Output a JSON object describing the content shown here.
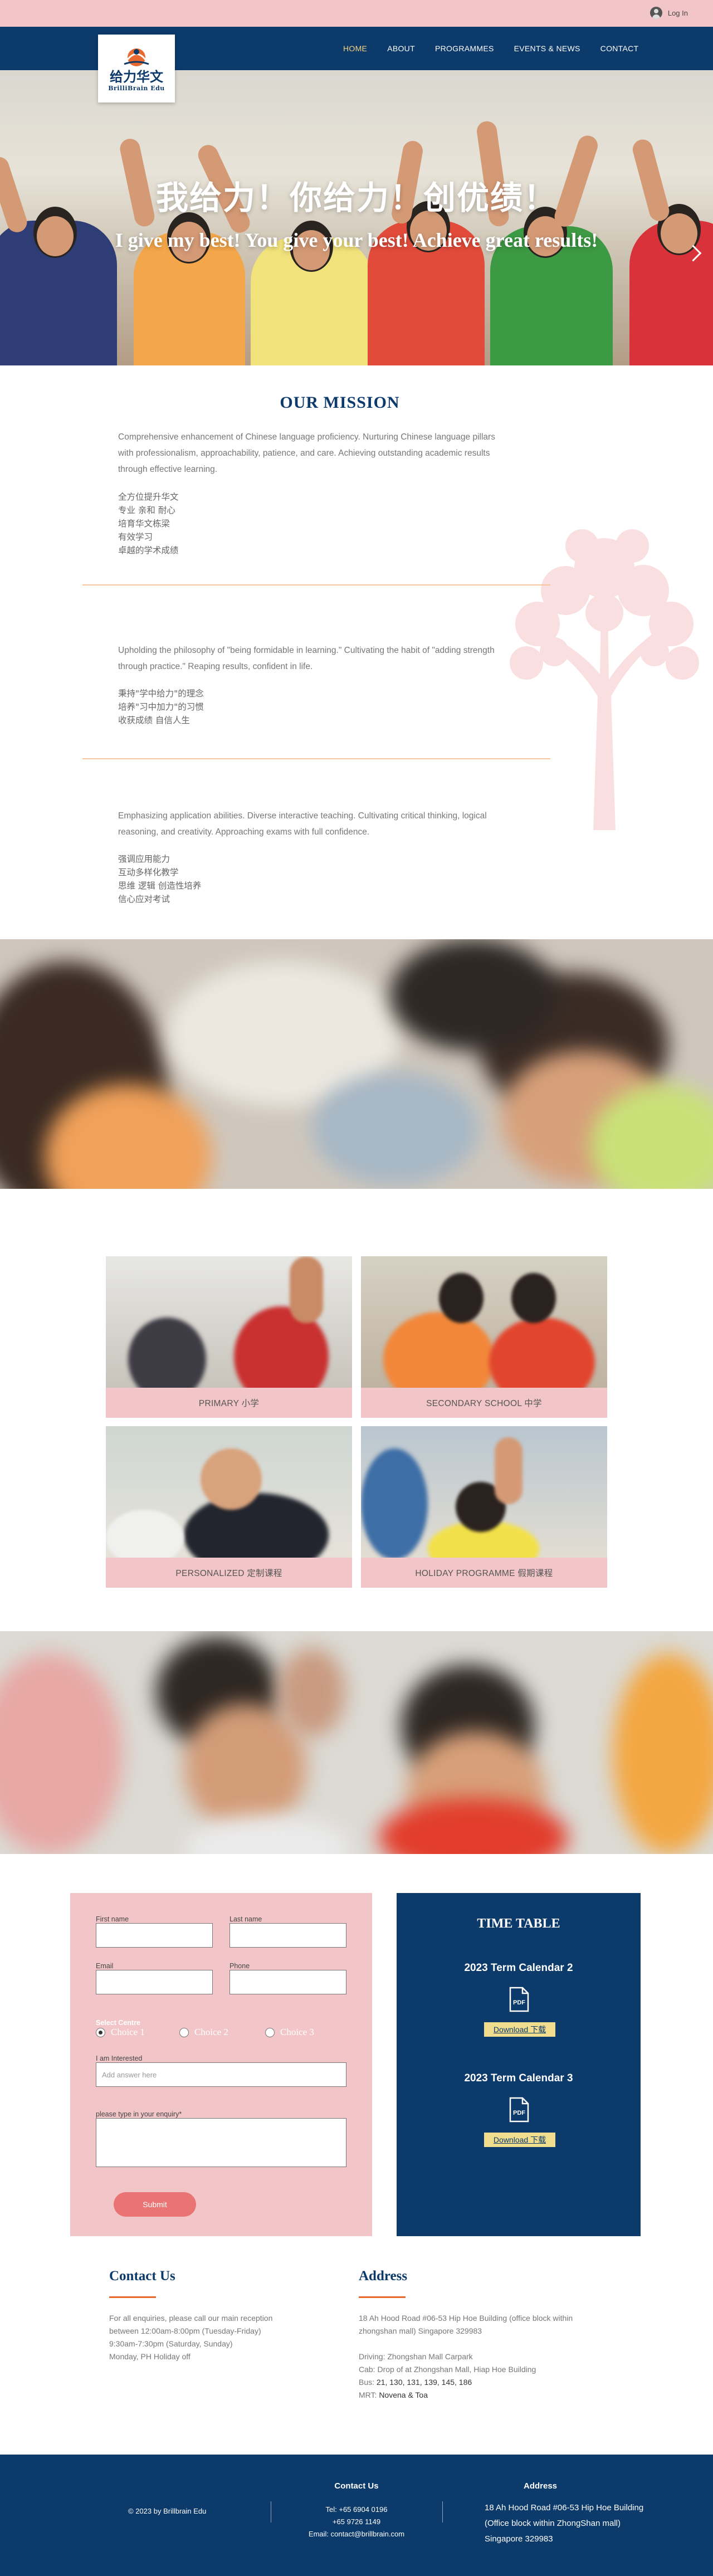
{
  "login": {
    "label": "Log In"
  },
  "brand": {
    "logo_cn": "给力华文",
    "logo_en": "BrilliBrain Edu"
  },
  "nav": {
    "items": [
      "HOME",
      "ABOUT",
      "PROGRAMMES",
      "EVENTS & NEWS",
      "CONTACT"
    ],
    "active": "HOME"
  },
  "hero": {
    "title_cn": "我给力！你给力！创优绩！",
    "title_en": "I give my best! You give your best! Achieve great results!"
  },
  "mission": {
    "title": "OUR MISSION",
    "blocks": [
      {
        "en": "Comprehensive enhancement of Chinese language proficiency. Nurturing Chinese language pillars with professionalism, approachability, patience, and care. Achieving outstanding academic results through effective learning.",
        "cn": [
          "全方位提升华文",
          "专业 亲和 耐心",
          "培育华文栋梁",
          "有效学习",
          "卓越的学术成绩"
        ]
      },
      {
        "en": "Upholding the philosophy of \"being formidable in learning.\" Cultivating the habit of \"adding strength through practice.\" Reaping results, confident in life.",
        "cn": [
          "秉持\"学中给力\"的理念",
          "培养\"习中加力\"的习惯",
          "收获成绩 自信人生"
        ]
      },
      {
        "en": "Emphasizing application abilities. Diverse interactive teaching. Cultivating critical thinking, logical reasoning, and creativity. Approaching exams with full confidence.",
        "cn": [
          "强调应用能力",
          "互动多样化教学",
          "思维 逻辑 创造性培养",
          "信心应对考试"
        ]
      }
    ]
  },
  "programmes": [
    {
      "label": "PRIMARY 小学"
    },
    {
      "label": "SECONDARY SCHOOL 中学"
    },
    {
      "label": "PERSONALIZED 定制课程"
    },
    {
      "label": "HOLIDAY PROGRAMME 假期课程"
    }
  ],
  "form": {
    "first_name_label": "First name",
    "last_name_label": "Last name",
    "email_label": "Email",
    "phone_label": "Phone",
    "centre_label": "Select Centre",
    "choices": [
      "Choice 1",
      "Choice 2",
      "Choice 3"
    ],
    "selected_choice": "Choice 1",
    "interest_label": "I am Interested",
    "interest_placeholder": "Add answer here",
    "enquiry_label": "please type in your enquiry*",
    "submit_label": "Submit"
  },
  "timetable": {
    "title": "TIME TABLE",
    "terms": [
      {
        "label": "2023 Term Calendar 2",
        "download": "Download 下载"
      },
      {
        "label": "2023 Term Calendar 3",
        "download": "Download 下载"
      }
    ]
  },
  "contact": {
    "title": "Contact Us",
    "lines": [
      "For all enquiries, please call our main reception",
      "between 12:00am-8:00pm (Tuesday-Friday)",
      "9:30am-7:30pm (Saturday, Sunday)",
      "Monday, PH Holiday off"
    ]
  },
  "address": {
    "title": "Address",
    "lines": [
      "18 Ah Hood Road #06-53 Hip Hoe Building (office block within",
      "zhongshan mall) Singapore 329983"
    ],
    "driving": "Driving: Zhongshan Mall Carpark",
    "cab": "Cab: Drop of at Zhongshan Mall, Hiap Hoe Building",
    "bus_label": "Bus: ",
    "bus_value": "21, 130, 131, 139, 145, 186",
    "mrt_label": "MRT: ",
    "mrt_value": "Novena & Toa"
  },
  "footer": {
    "copyright": "© 2023 by Brillbrain Edu",
    "contact_title": "Contact Us",
    "tel": "Tel: +65 6904 0196",
    "tel2": "+65 9726 1149",
    "email": "Email: contact@brillbrain.com",
    "address_title": "Address",
    "address_lines": [
      "18 Ah Hood Road #06-53 Hip Hoe Building",
      "(Office block within ZhongShan mall)",
      "Singapore 329983"
    ]
  },
  "colors": {
    "navy": "#0c3a6b",
    "pink": "#f2c6c8",
    "accent_orange": "#e8692f",
    "button_red": "#ea7474",
    "download_yellow": "#f0dd8e",
    "nav_active": "#f5d482"
  },
  "icons": {
    "login": "user-avatar-icon",
    "next": "chevron-right-icon",
    "pdf": "pdf-file-icon"
  }
}
